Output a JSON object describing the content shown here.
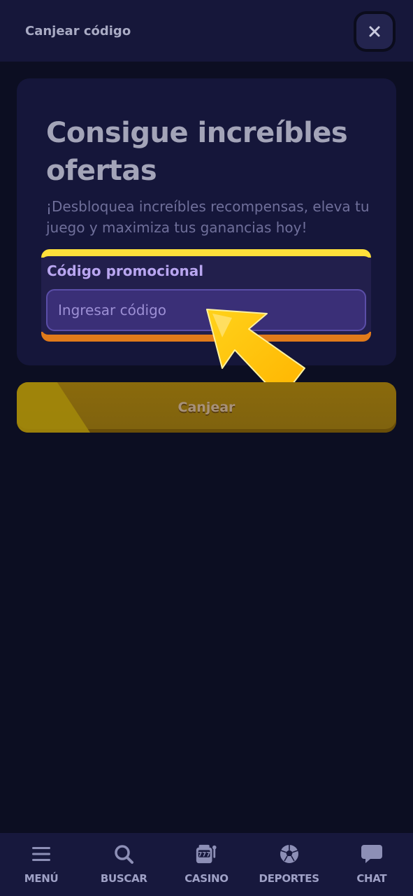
{
  "header": {
    "title": "Canjear código",
    "close_icon": "close-icon"
  },
  "card": {
    "title": "Consigue increíbles ofertas",
    "subtitle": "¡Desbloquea increíbles recompensas, eleva tu juego y maximiza tus ganancias hoy!"
  },
  "promo": {
    "label": "Código promocional",
    "placeholder": "Ingresar código",
    "value": ""
  },
  "redeem": {
    "label": "Canjear"
  },
  "nav": {
    "items": [
      {
        "label": "MENÚ",
        "icon": "menu-icon"
      },
      {
        "label": "BUSCAR",
        "icon": "search-icon"
      },
      {
        "label": "CASINO",
        "icon": "slot-machine-icon"
      },
      {
        "label": "DEPORTES",
        "icon": "soccer-ball-icon"
      },
      {
        "label": "CHAT",
        "icon": "chat-icon"
      }
    ]
  },
  "colors": {
    "background": "#0c0e22",
    "header": "#16173a",
    "card": "#15163a",
    "highlight_yellow": "#ffe03a",
    "highlight_orange": "#e07a1a",
    "redeem_button": "#8a6a0c",
    "pointer_arrow": "#ffc400"
  }
}
